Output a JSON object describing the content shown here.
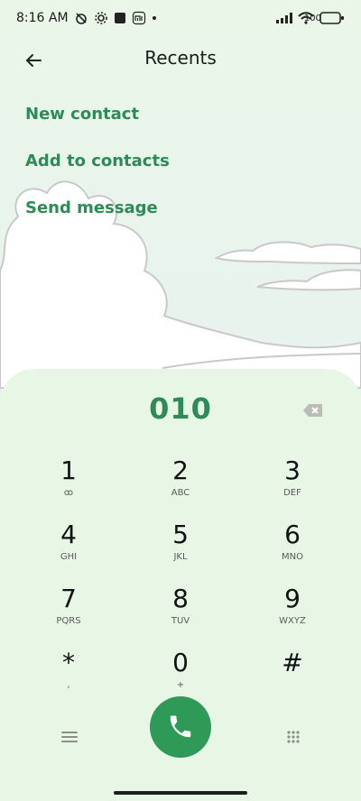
{
  "status_bar": {
    "time": "8:16 AM",
    "battery": "100",
    "icons": [
      "alarm-off-icon",
      "settings-icon",
      "square-icon",
      "mi-icon",
      "signal-icon",
      "wifi-icon",
      "battery-icon"
    ]
  },
  "header": {
    "title": "Recents"
  },
  "actions": [
    "New contact",
    "Add to contacts",
    "Send message"
  ],
  "dialer": {
    "number": "010",
    "keys": [
      {
        "digit": "1",
        "letters": "ꝏ"
      },
      {
        "digit": "2",
        "letters": "ABC"
      },
      {
        "digit": "3",
        "letters": "DEF"
      },
      {
        "digit": "4",
        "letters": "GHI"
      },
      {
        "digit": "5",
        "letters": "JKL"
      },
      {
        "digit": "6",
        "letters": "MNO"
      },
      {
        "digit": "7",
        "letters": "PQRS"
      },
      {
        "digit": "8",
        "letters": "TUV"
      },
      {
        "digit": "9",
        "letters": "WXYZ"
      },
      {
        "digit": "*",
        "letters": ","
      },
      {
        "digit": "0",
        "letters": "+"
      },
      {
        "digit": "#",
        "letters": ""
      }
    ]
  },
  "colors": {
    "accent": "#2e8b57",
    "background": "#e9f6e8"
  }
}
